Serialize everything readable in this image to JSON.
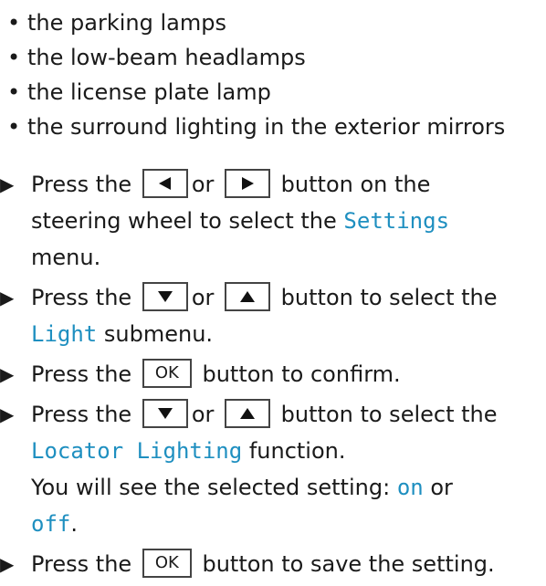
{
  "bullets": [
    "the parking lamps",
    "the low-beam headlamps",
    "the license plate lamp",
    "the surround lighting in the exterior mirrors"
  ],
  "icons": {
    "step_arrow": "black-right-triangle",
    "key_left": "left-triangle",
    "key_right": "right-triangle",
    "key_down": "down-triangle",
    "key_up": "up-triangle"
  },
  "keys": {
    "ok": "OK"
  },
  "display_color": "#1e8fc0",
  "steps": {
    "s1": {
      "press": "Press the",
      "or": "or",
      "rest_line1": "button on the",
      "line2_pre": "steering wheel to select the",
      "menu": "Settings",
      "line3": "menu."
    },
    "s2": {
      "press": "Press the",
      "or": "or",
      "rest_line1": "button to select the",
      "submenu": "Light",
      "line2_post": "submenu."
    },
    "s3": {
      "press": "Press the",
      "rest": "button to confirm."
    },
    "s4": {
      "press": "Press the",
      "or": "or",
      "rest_line1": "button to select the",
      "function": "Locator Lighting",
      "line2_post": "function.",
      "line3": "You will see the selected setting:",
      "on": "on",
      "or2": "or",
      "off": "off",
      "period": "."
    },
    "s5": {
      "press": "Press the",
      "rest": "button to save the setting."
    }
  }
}
